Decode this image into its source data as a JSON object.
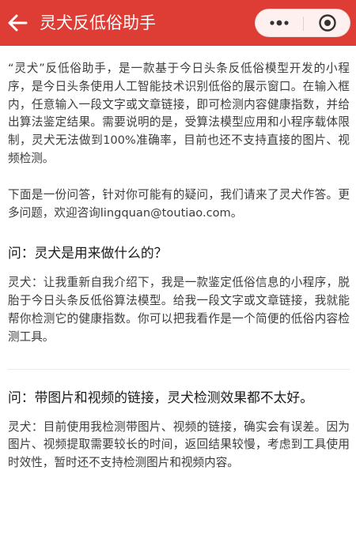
{
  "nav": {
    "title": "灵犬反低俗助手",
    "bg": "#dd3d34",
    "back_icon": "arrow-left-icon",
    "more_icon": "more-dots-icon",
    "close_icon": "target-circle-icon"
  },
  "content": {
    "intro": "“灵犬”反低俗助手，是一款基于今日头条反低俗模型开发的小程序，是今日头条使用人工智能技术识别低俗的展示窗口。在输入框内，任意输入一段文字或文章链接，即可检测内容健康指数，并给出算法鉴定结果。需要说明的是，受算法模型应用和小程序载体限制，灵犬无法做到100%准确率，目前也还不支持直接的图片、视频检测。",
    "faq_intro": "下面是一份问答，针对你可能有的疑问，我们请来了灵犬作答。更多问题，欢迎咨询lingquan@toutiao.com。",
    "qa": [
      {
        "question": "问：灵犬是用来做什么的？",
        "answer": "灵犬：让我重新自我介绍下，我是一款鉴定低俗信息的小程序，脱胎于今日头条反低俗算法模型。给我一段文字或文章链接，我就能帮你检测它的健康指数。你可以把我看作是一个简便的低俗内容检测工具。"
      },
      {
        "question": "问：带图片和视频的链接，灵犬检测效果都不太好。",
        "answer": "灵犬：目前使用我检测带图片、视频的链接，确实会有误差。因为图片、视频提取需要较长的时间，返回结果较慢，考虑到工具使用时效性，暂时还不支持检测图片和视频内容。"
      }
    ]
  }
}
